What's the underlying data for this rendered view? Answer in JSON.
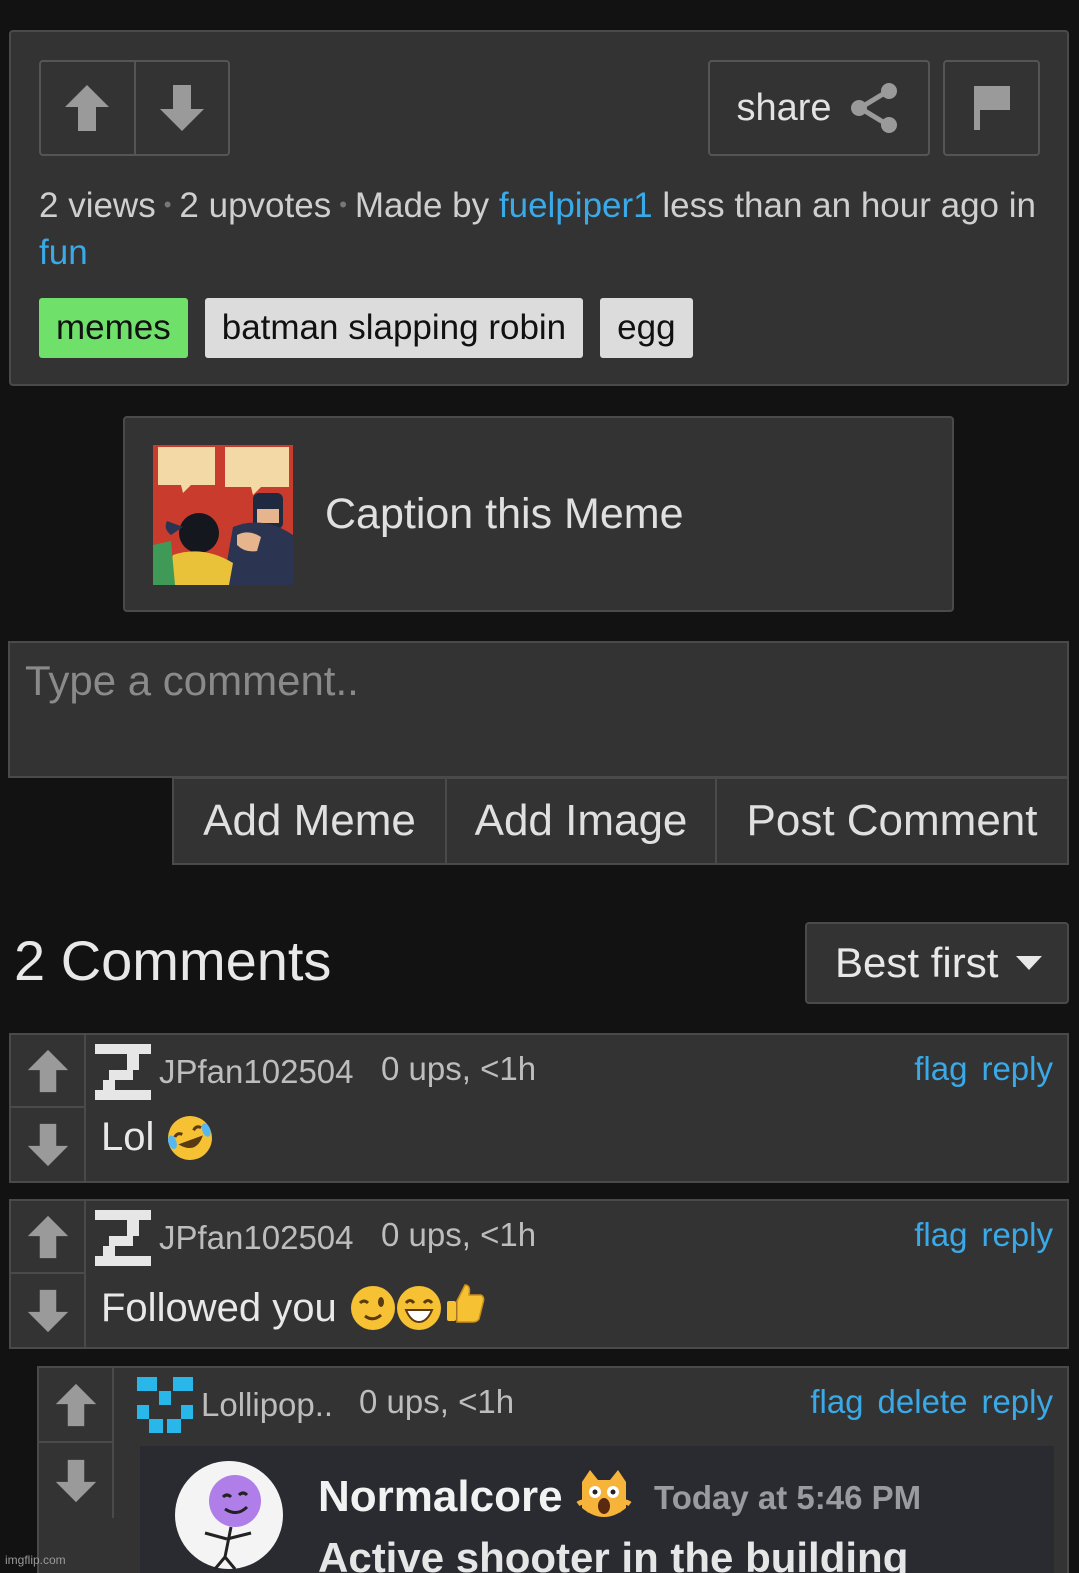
{
  "post": {
    "share_label": "share",
    "views": "2 views",
    "upvotes": "2 upvotes",
    "made_by_prefix": "Made by",
    "author": "fuelpiper1",
    "time": "less than an hour ago",
    "in_prefix": "in",
    "stream": "fun",
    "tags": [
      "memes",
      "batman slapping robin",
      "egg"
    ]
  },
  "caption": {
    "label": "Caption this Meme"
  },
  "comment_form": {
    "placeholder": "Type a comment..",
    "buttons": [
      "Add Meme",
      "Add Image",
      "Post Comment"
    ]
  },
  "comments_header": {
    "title": "2 Comments",
    "sort_value": "Best first"
  },
  "comments": [
    {
      "username": "JPfan102504",
      "meta": "0 ups, <1h",
      "text": "Lol",
      "actions": [
        "flag",
        "reply"
      ]
    },
    {
      "username": "JPfan102504",
      "meta": "0 ups, <1h",
      "text": "Followed you",
      "actions": [
        "flag",
        "reply"
      ]
    },
    {
      "username": "Lollipop..",
      "meta": "0 ups, <1h",
      "actions": [
        "flag",
        "delete",
        "reply"
      ]
    }
  ],
  "embed": {
    "display_name": "Normalcore",
    "timestamp": "Today at 5:46 PM",
    "message": "Active shooter in the building"
  },
  "watermark": "imgflip.com",
  "colors": {
    "link": "#3aa9e8",
    "tag_active": "#6fe06a",
    "reply_bar": "#ff8a1f",
    "background": "#121212",
    "panel": "#333333"
  }
}
